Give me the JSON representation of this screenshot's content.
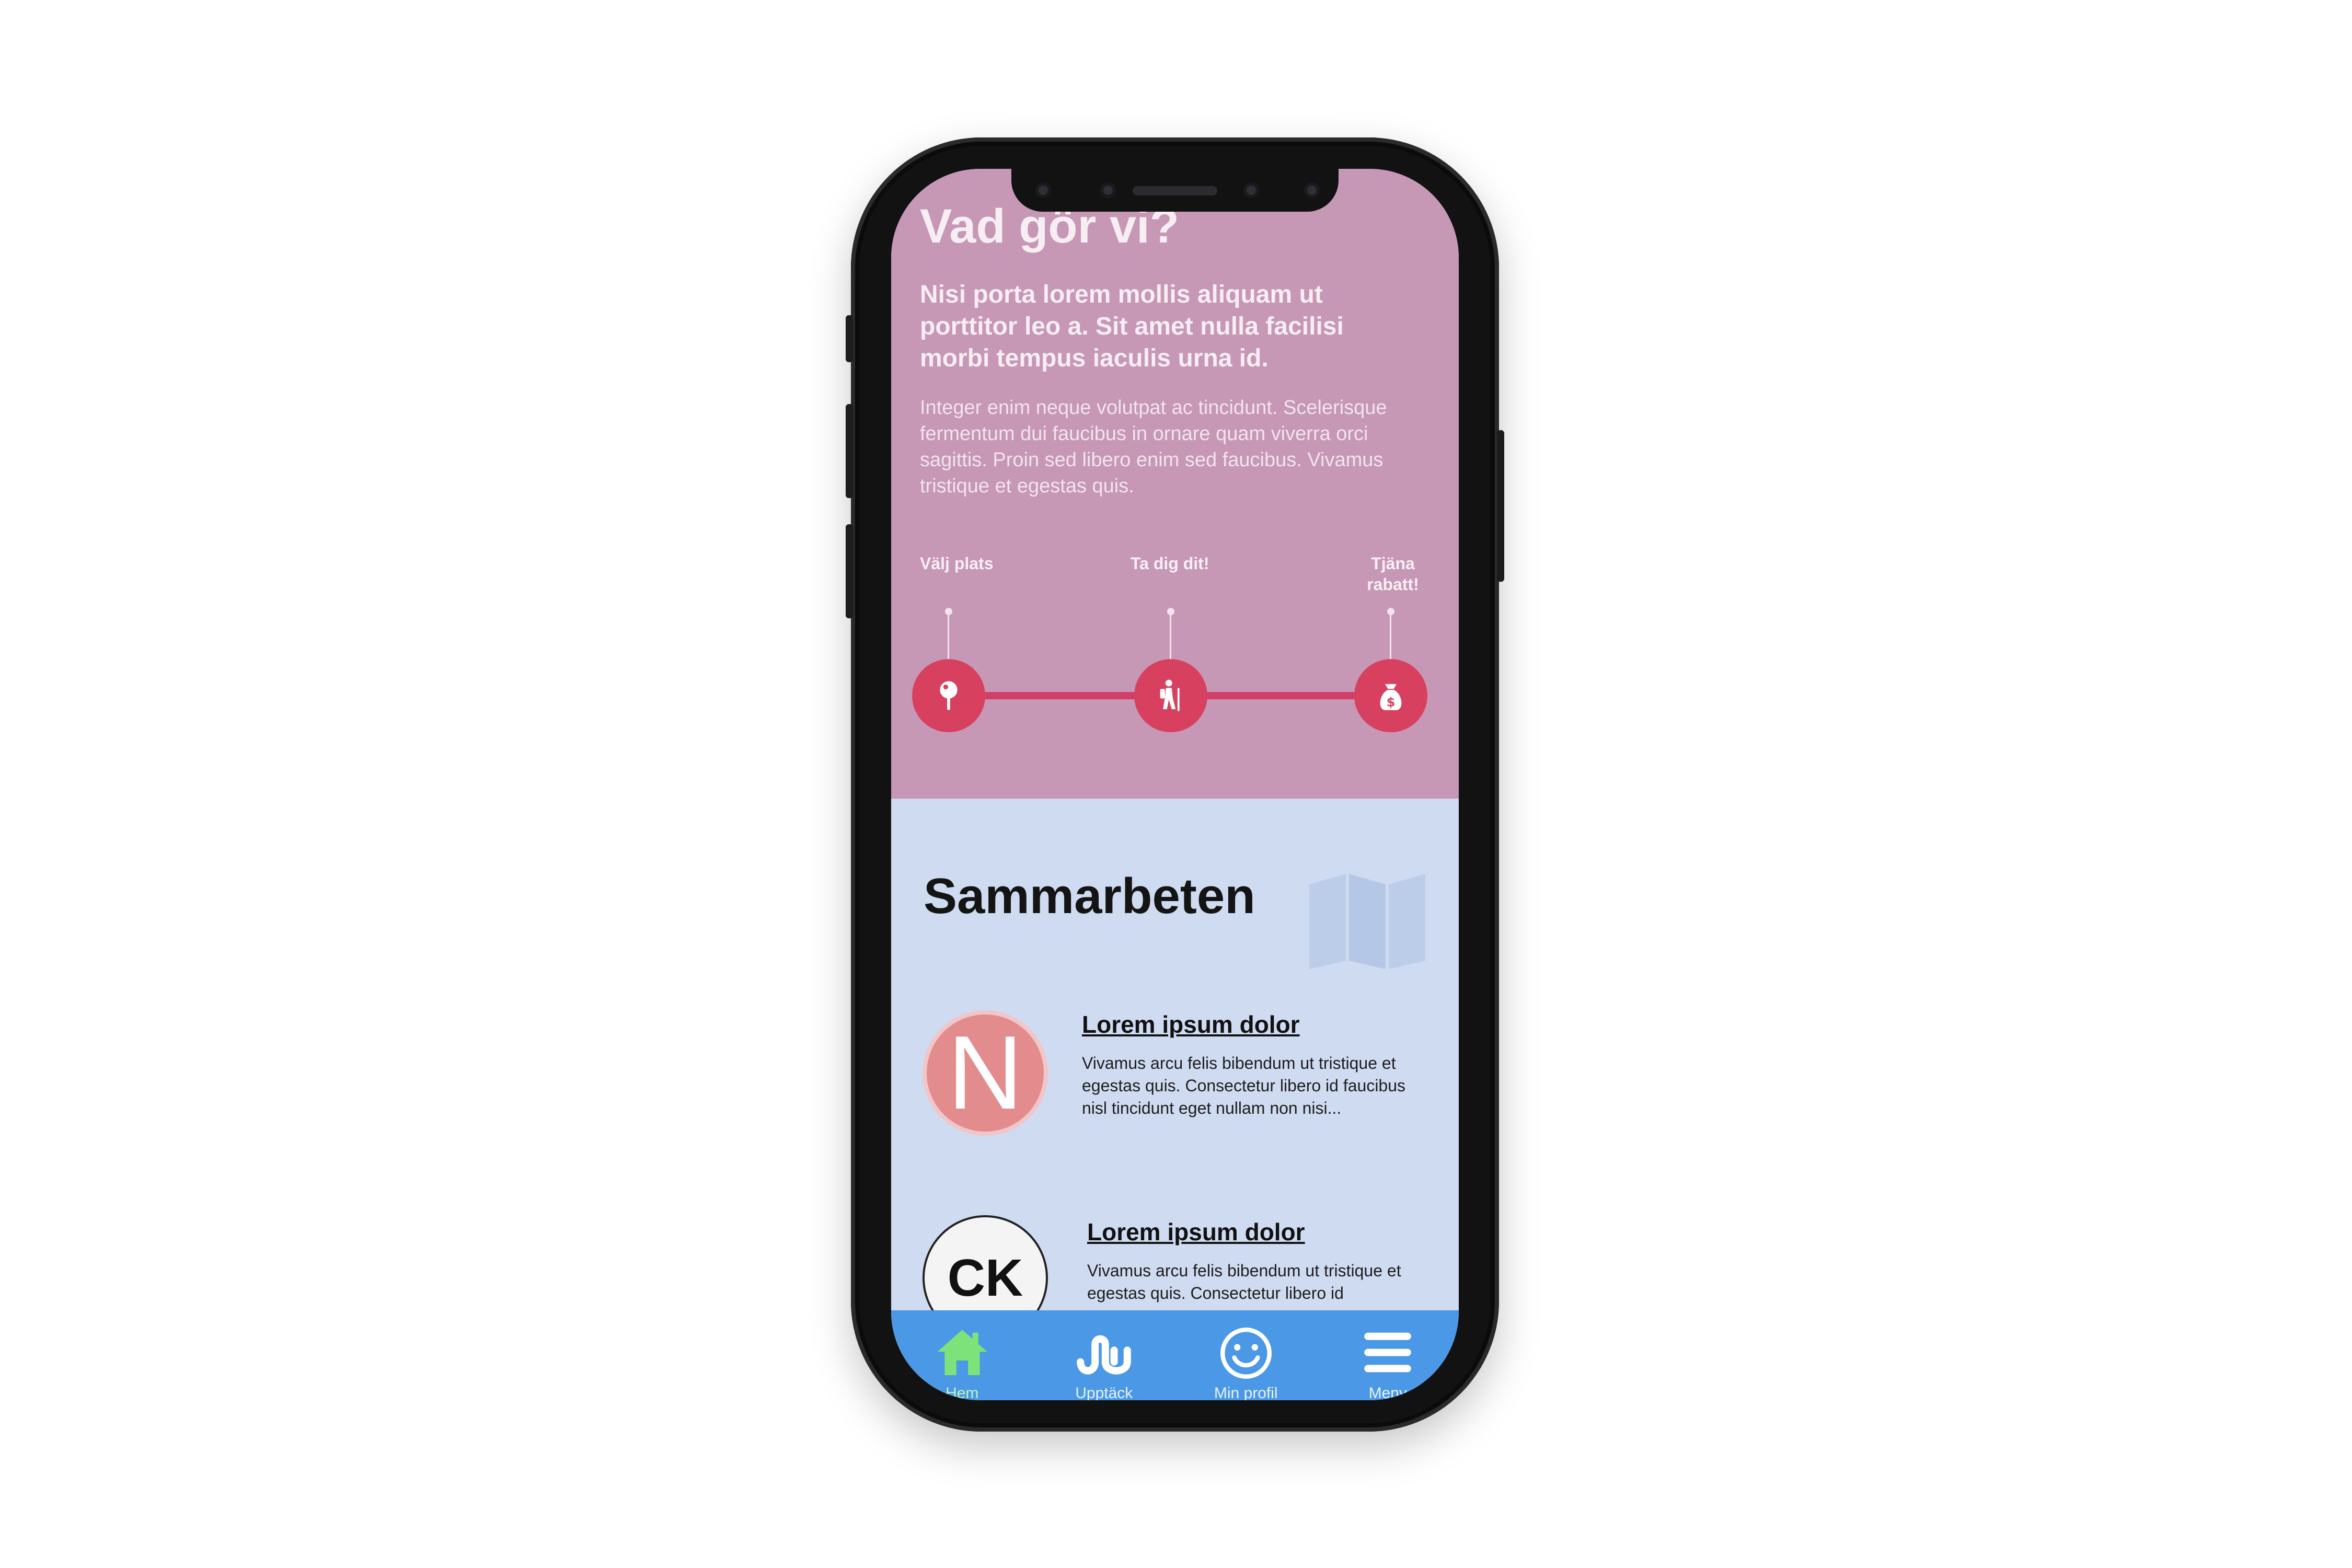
{
  "section_intro": {
    "title": "Vad gör vi?",
    "lead": "Nisi porta lorem mollis aliquam ut porttitor leo a. Sit amet nulla facilisi morbi tempus iaculis urna id.",
    "body": "Integer enim neque volutpat ac tincidunt. Scelerisque fermentum dui faucibus in ornare quam viverra orci sagittis. Proin sed libero enim sed faucibus. Vivamus tristique et egestas quis."
  },
  "steps": [
    {
      "label": "Välj plats",
      "icon": "map-pin-icon"
    },
    {
      "label": "Ta dig dit!",
      "icon": "hiker-icon"
    },
    {
      "label": "Tjäna rabatt!",
      "icon": "money-bag-icon"
    }
  ],
  "partners": {
    "title": "Sammarbeten",
    "items": [
      {
        "logo_text": "N",
        "title": "Lorem ipsum dolor",
        "text": "Vivamus arcu felis bibendum ut tristique et egestas quis. Consectetur libero id faucibus nisl tincidunt eget nullam non nisi..."
      },
      {
        "logo_text": "CK",
        "title": "Lorem ipsum dolor",
        "text": "Vivamus arcu felis bibendum ut tristique et egestas quis. Consectetur libero id"
      }
    ]
  },
  "nav": {
    "items": [
      {
        "label": "Hem",
        "icon": "home-icon",
        "active": true
      },
      {
        "label": "Upptäck",
        "icon": "discover-icon",
        "active": false
      },
      {
        "label": "Min profil",
        "icon": "smiley-icon",
        "active": false
      },
      {
        "label": "Meny",
        "icon": "hamburger-menu-icon",
        "active": false
      }
    ]
  },
  "colors": {
    "intro_background": "#c797b6",
    "accent": "#d8405f",
    "partners_background": "#cfdbf0",
    "navbar": "#4a98e6",
    "active_nav": "#7ee27a"
  }
}
